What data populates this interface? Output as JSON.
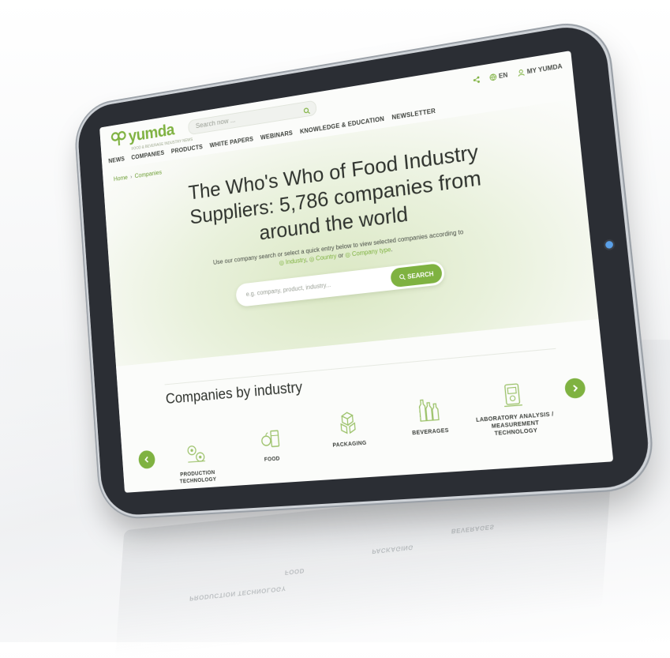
{
  "colors": {
    "brand_green": "#7fb241",
    "bezel": "#2b2e34",
    "camera": "#5aa0e8"
  },
  "header": {
    "logo_text": "yumda",
    "logo_tagline": "FOOD & BEVERAGE INDUSTRY NEWS",
    "search_placeholder": "Search now ...",
    "share_icon": "share-icon",
    "language": "EN",
    "account_label": "MY YUMDA"
  },
  "nav": {
    "items": [
      "NEWS",
      "COMPANIES",
      "PRODUCTS",
      "WHITE PAPERS",
      "WEBINARS",
      "KNOWLEDGE & EDUCATION",
      "NEWSLETTER"
    ]
  },
  "breadcrumb": {
    "home": "Home",
    "separator": "›",
    "current": "Companies"
  },
  "hero": {
    "title": "The Who's Who of Food Industry Suppliers: 5,786 companies from around the world",
    "subtitle_prefix": "Use our company search or select a quick entry below to view selected companies according to",
    "link_industry": "Industry",
    "link_country": "Country",
    "link_or": "or",
    "link_company_type": "Company type",
    "search_placeholder": "e.g. company, product, industry...",
    "search_button": "SEARCH"
  },
  "industry": {
    "title": "Companies by industry",
    "categories": [
      {
        "label": "PRODUCTION TECHNOLOGY",
        "icon": "gears-icon"
      },
      {
        "label": "FOOD",
        "icon": "food-basket-icon"
      },
      {
        "label": "PACKAGING",
        "icon": "boxes-icon"
      },
      {
        "label": "BEVERAGES",
        "icon": "bottles-icon"
      },
      {
        "label": "LABORATORY ANALYSIS / MEASUREMENT TECHNOLOGY",
        "icon": "lab-device-icon"
      }
    ]
  }
}
